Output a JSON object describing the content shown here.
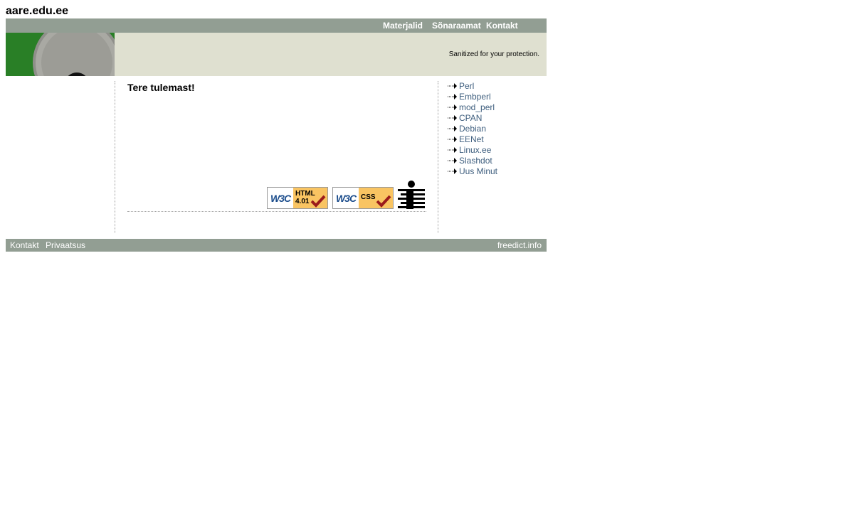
{
  "header": {
    "site_title": "aare.edu.ee"
  },
  "topnav": {
    "items": [
      "Materjalid",
      "Sõnaraamat",
      "Kontakt"
    ]
  },
  "banner": {
    "notice": "Sanitized for your protection."
  },
  "main": {
    "title": "Tere tulemast!",
    "badges": [
      {
        "brand": "W3C",
        "label_line1": "HTML",
        "label_line2": "4.01"
      },
      {
        "brand": "W3C",
        "label_line1": "CSS",
        "label_line2": ""
      }
    ]
  },
  "sidebar": {
    "links": [
      "Perl",
      "Embperl",
      "mod_perl",
      "CPAN",
      "Debian",
      "EENet",
      "Linux.ee",
      "Slashdot",
      "Uus Minut"
    ]
  },
  "footer": {
    "left_links": [
      "Kontakt",
      "Privaatsus"
    ],
    "right_link": "freedict.info"
  },
  "colors": {
    "nav_bg": "#929e93",
    "banner_bg": "#dfe0d0",
    "link": "#3e5e7e",
    "banner_green": "#2f8a2c"
  }
}
